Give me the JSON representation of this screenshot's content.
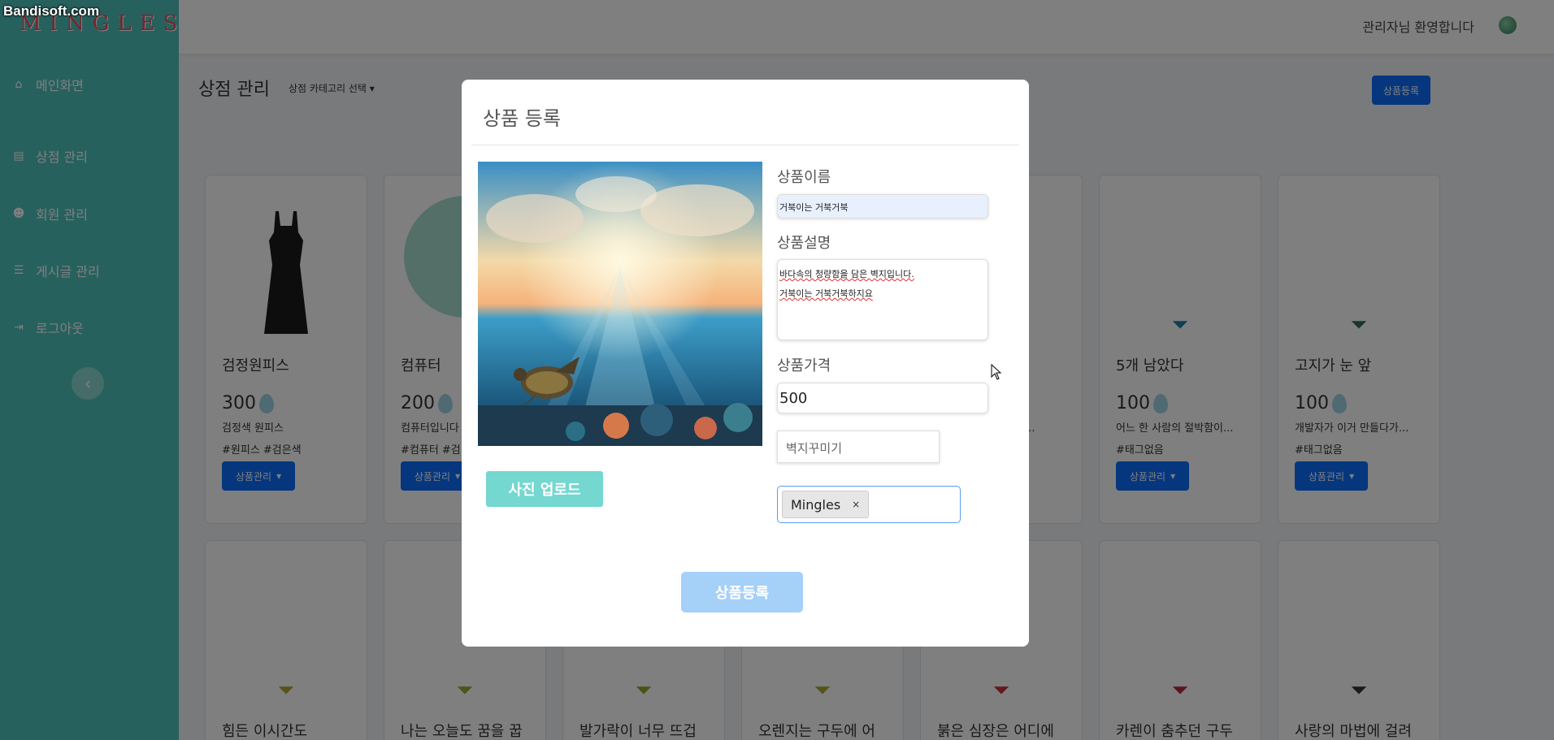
{
  "watermark": "Bandisoft.com",
  "brand": {
    "logo": "MINGLES",
    "accent": "#4fc3bd"
  },
  "sidebar": {
    "items": [
      {
        "label": "메인화면",
        "icon": "home-icon"
      },
      {
        "label": "상점 관리",
        "icon": "store-icon"
      },
      {
        "label": "회원 관리",
        "icon": "users-icon"
      },
      {
        "label": "게시글 관리",
        "icon": "list-icon"
      },
      {
        "label": "로그아웃",
        "icon": "logout-icon"
      }
    ]
  },
  "header": {
    "welcome": "관리자님 환영합니다"
  },
  "main": {
    "title": "상점 관리",
    "category_select": "상점 카테고리 선택",
    "register_button": "상품등록",
    "cards": [
      {
        "name": "검정원피스",
        "price": "300",
        "desc": "검정색 원피스",
        "tags": "#원피스 #검은색",
        "button": "상품관리"
      },
      {
        "name": "컴퓨터",
        "price": "200",
        "desc": "컴퓨터입니다",
        "tags": "#컴퓨터 #검",
        "button": "상품관리"
      },
      {
        "name": "5개 남았다",
        "price": "100",
        "desc": "어느 한 사람의 절박함이...",
        "tags": "#태그없음",
        "button": "상품관리"
      },
      {
        "name": "고지가 눈 앞",
        "price": "100",
        "desc": "개발자가 이거 만들다가...",
        "tags": "#태그없음",
        "button": "상품관리"
      },
      {
        "name": "힘든 이시간도"
      },
      {
        "name": "나는 오늘도 꿈을 꿉"
      },
      {
        "name": "발가락이 너무 뜨겁"
      },
      {
        "name": "오렌지는 구두에 어"
      },
      {
        "name": "붉은 심장은 어디에"
      },
      {
        "name": "카렌이 춤추던 구두"
      },
      {
        "name": "사랑의 마법에 걸려"
      }
    ],
    "partial_desc": "는 자..."
  },
  "modal": {
    "title": "상품 등록",
    "upload_button": "사진 업로드",
    "name_label": "상품이름",
    "name_value": "거북이는 거북거북",
    "desc_label": "상품설명",
    "desc_line1": "바다속의 청량함을 담은 벽지입니다.",
    "desc_line2": "거북이는 거북거북하지요",
    "price_label": "상품가격",
    "price_value": "500",
    "category_value": "벽지꾸미기",
    "tag": "Mingles",
    "tag_remove": "×",
    "submit_button": "상품등록"
  }
}
